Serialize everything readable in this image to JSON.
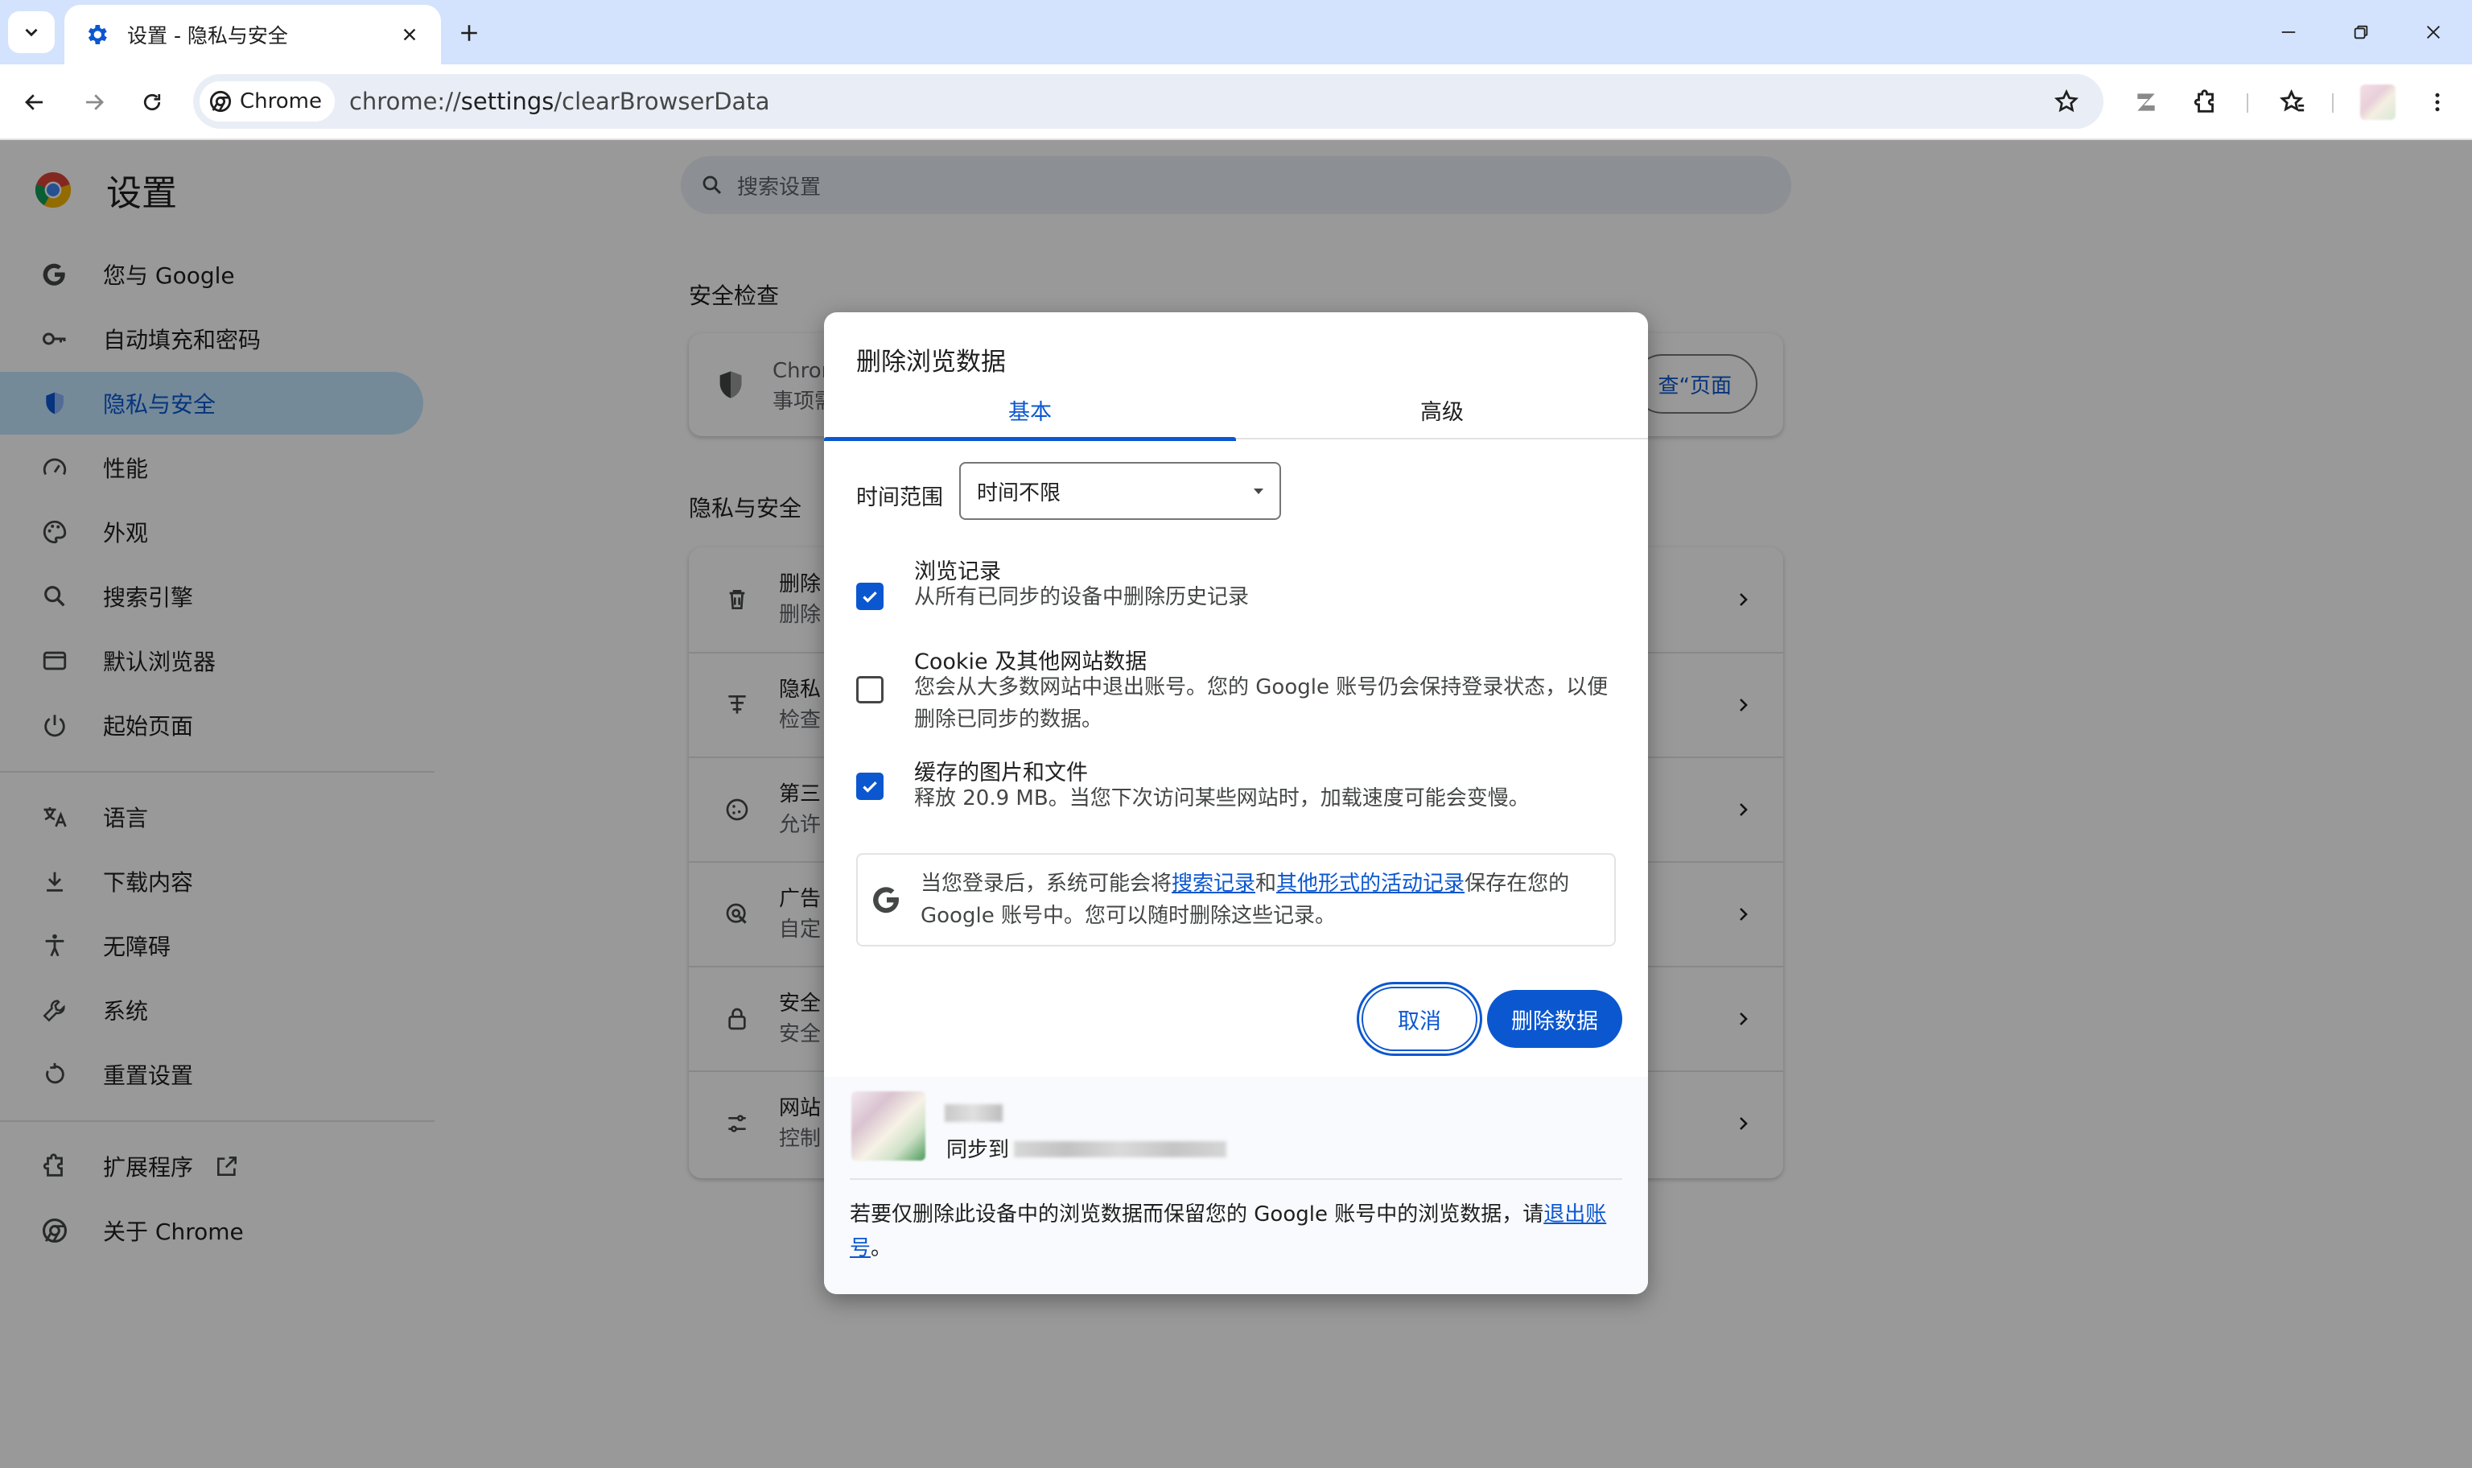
{
  "tab": {
    "title": "设置 - 隐私与安全"
  },
  "omnibox": {
    "chip": "Chrome",
    "url_prefix": "chrome://",
    "url_main": "settings",
    "url_suffix": "/clearBrowserData"
  },
  "settings": {
    "title": "设置",
    "search_placeholder": "搜索设置",
    "nav": [
      {
        "label": "您与 Google",
        "icon": "google-g-icon"
      },
      {
        "label": "自动填充和密码",
        "icon": "key-icon"
      },
      {
        "label": "隐私与安全",
        "icon": "shield-icon"
      },
      {
        "label": "性能",
        "icon": "speedometer-icon"
      },
      {
        "label": "外观",
        "icon": "palette-icon"
      },
      {
        "label": "搜索引擎",
        "icon": "search-icon"
      },
      {
        "label": "默认浏览器",
        "icon": "browser-window-icon"
      },
      {
        "label": "起始页面",
        "icon": "power-icon"
      },
      {
        "label": "语言",
        "icon": "translate-icon"
      },
      {
        "label": "下载内容",
        "icon": "download-icon"
      },
      {
        "label": "无障碍",
        "icon": "accessibility-icon"
      },
      {
        "label": "系统",
        "icon": "wrench-icon"
      },
      {
        "label": "重置设置",
        "icon": "reset-icon"
      },
      {
        "label": "扩展程序",
        "icon": "puzzle-icon"
      },
      {
        "label": "关于 Chrome",
        "icon": "chrome-icon"
      }
    ],
    "safety_check": {
      "heading": "安全检查",
      "line1": "Chron",
      "line2": "事项需",
      "button": "查“页面"
    },
    "privacy": {
      "heading": "隐私与安全",
      "rows": [
        {
          "line1": "删除",
          "line2": "删除",
          "icon": "trash-icon"
        },
        {
          "line1": "隐私",
          "line2": "检查",
          "icon": "privacy-guide-icon"
        },
        {
          "line1": "第三",
          "line2": "允许",
          "icon": "cookie-icon"
        },
        {
          "line1": "广告",
          "line2": "自定",
          "icon": "ad-privacy-icon"
        },
        {
          "line1": "安全",
          "line2": "安全",
          "icon": "lock-icon"
        },
        {
          "line1": "网站",
          "line2": "控制",
          "icon": "sliders-icon"
        }
      ]
    }
  },
  "dialog": {
    "title": "删除浏览数据",
    "tabs": [
      "基本",
      "高级"
    ],
    "time_range_label": "时间范围",
    "time_range_value": "时间不限",
    "options": [
      {
        "label": "浏览记录",
        "desc": "从所有已同步的设备中删除历史记录",
        "checked": true
      },
      {
        "label": "Cookie 及其他网站数据",
        "desc": "您会从大多数网站中退出账号。您的 Google 账号仍会保持登录状态，以便删除已同步的数据。",
        "checked": false
      },
      {
        "label": "缓存的图片和文件",
        "desc": "释放 20.9 MB。当您下次访问某些网站时，加载速度可能会变慢。",
        "checked": true
      }
    ],
    "google_notice": {
      "part1": "当您登录后，系统可能会将",
      "link1": "搜索记录",
      "part2": "和",
      "link2": "其他形式的活动记录",
      "part3": "保存在您的 Google 账号中。您可以随时删除这些记录。"
    },
    "cancel": "取消",
    "delete": "删除数据",
    "sync_label": "同步到",
    "footer": {
      "text": "若要仅删除此设备中的浏览数据而保留您的 Google 账号中的浏览数据，请",
      "link": "退出账号",
      "end": "。"
    }
  },
  "colors": {
    "accent": "#0b57d0",
    "titlebar": "#d3e3fd",
    "active_nav": "#c2e7ff"
  }
}
